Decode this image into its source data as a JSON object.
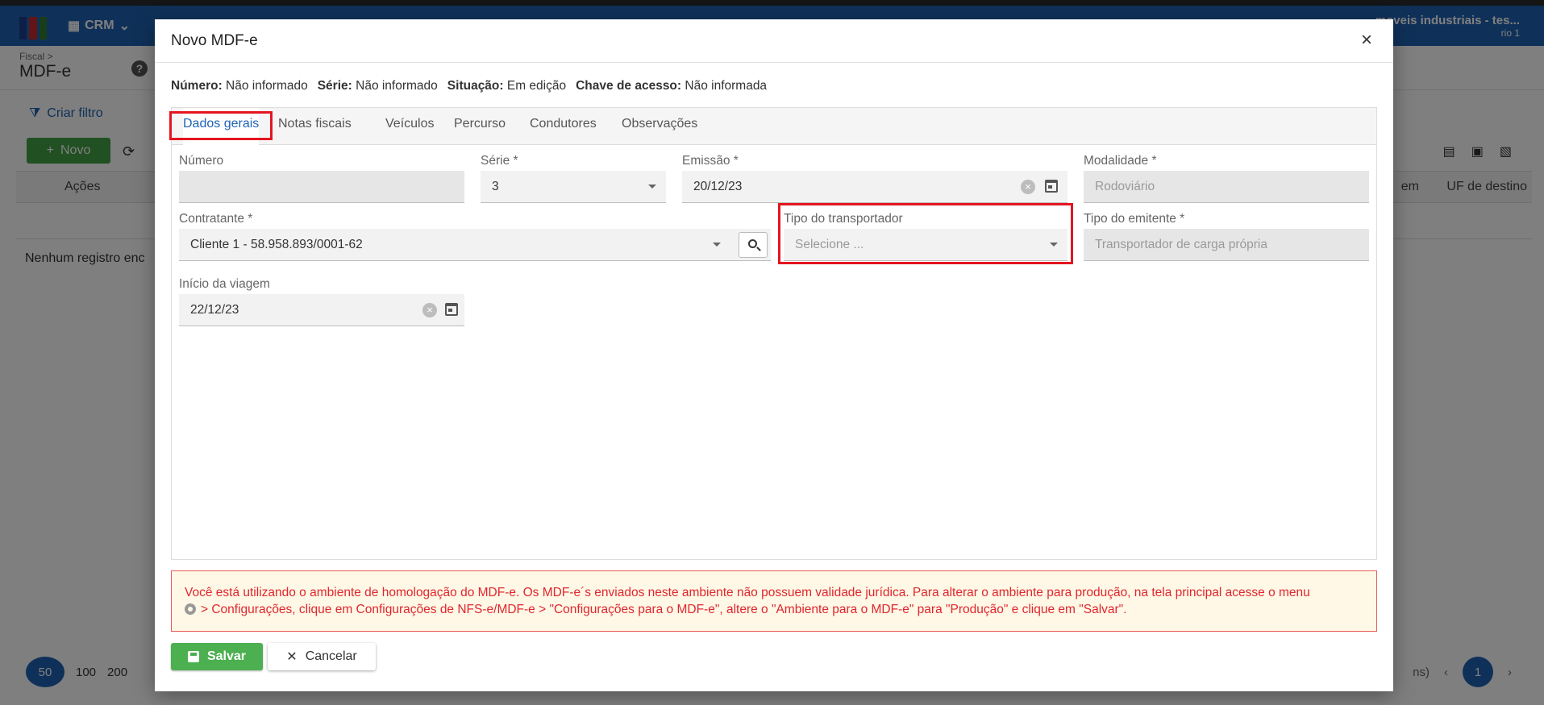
{
  "background": {
    "menu_label": "CRM",
    "company_name": "moveis industriais - tes...",
    "user_line": "rio 1",
    "breadcrumb_parent": "Fiscal >",
    "page_title": "MDF-e",
    "filter_label": "Criar filtro",
    "new_button": "Novo",
    "col_acoes": "Ações",
    "col_em": "em",
    "col_uf_destino": "UF de destino",
    "empty_message": "Nenhum registro enc",
    "page_sizes": [
      "50",
      "100",
      "200"
    ],
    "pager_suffix": "ns)",
    "current_page": "1"
  },
  "modal": {
    "title": "Novo MDF-e",
    "info": {
      "numero_label": "Número:",
      "numero_value": "Não informado",
      "serie_label": "Série:",
      "serie_value": "Não informado",
      "situacao_label": "Situação:",
      "situacao_value": "Em edição",
      "chave_label": "Chave de acesso:",
      "chave_value": "Não informada"
    },
    "tabs": [
      {
        "label": "Dados gerais"
      },
      {
        "label": "Notas fiscais"
      },
      {
        "label": "Veículos"
      },
      {
        "label": "Percurso"
      },
      {
        "label": "Condutores"
      },
      {
        "label": "Observações"
      }
    ],
    "active_tab": "Dados gerais",
    "fields": {
      "numero": {
        "label": "Número",
        "value": ""
      },
      "serie": {
        "label": "Série *",
        "value": "3"
      },
      "emissao": {
        "label": "Emissão *",
        "value": "20/12/23"
      },
      "modalidade": {
        "label": "Modalidade *",
        "value": "Rodoviário"
      },
      "contratante": {
        "label": "Contratante *",
        "value": "Cliente 1 - 58.958.893/0001-62"
      },
      "tipo_transportador": {
        "label": "Tipo do transportador",
        "placeholder": "Selecione ..."
      },
      "tipo_emitente": {
        "label": "Tipo do emitente *",
        "value": "Transportador de carga própria"
      },
      "inicio_viagem": {
        "label": "Início da viagem",
        "value": "22/12/23"
      }
    },
    "warning_line1": "Você está utilizando o ambiente de homologação do MDF-e. Os MDF-e´s enviados neste ambiente não possuem validade jurídica. Para alterar o ambiente para produção, na tela principal acesse o menu",
    "warning_line2": "> Configurações, clique em Configurações de NFS-e/MDF-e > \"Configurações para o MDF-e\", altere o \"Ambiente para o MDF-e\" para \"Produção\" e clique em \"Salvar\".",
    "save_button": "Salvar",
    "cancel_button": "Cancelar"
  },
  "colors": {
    "brand_blue": "#1f63b3",
    "highlight_red": "#e4151f",
    "save_green": "#4caf50",
    "warning_text": "#e0262f"
  }
}
